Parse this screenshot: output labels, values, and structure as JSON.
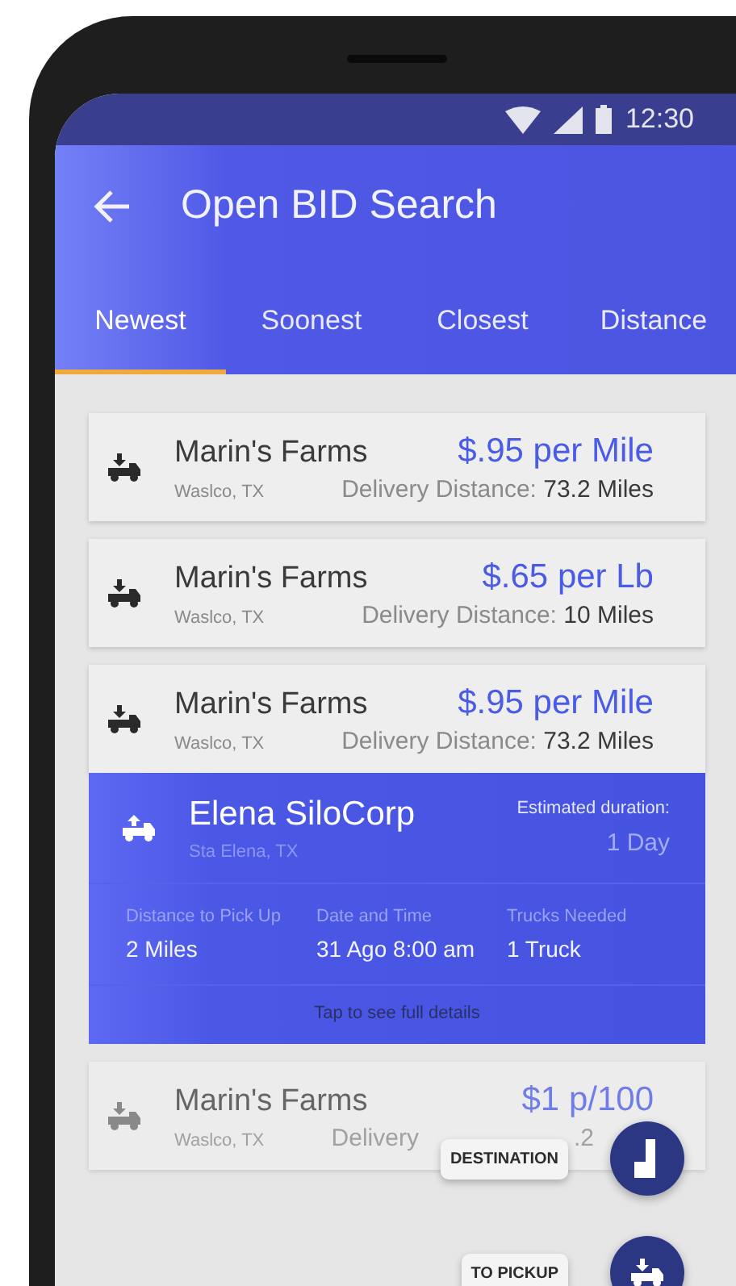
{
  "status_bar": {
    "time": "12:30"
  },
  "app_bar": {
    "title": "Open BID Search"
  },
  "tabs": [
    {
      "label": "Newest",
      "selected": true
    },
    {
      "label": "Soonest",
      "selected": false
    },
    {
      "label": "Closest",
      "selected": false
    },
    {
      "label": "Distance",
      "selected": false
    }
  ],
  "bids": [
    {
      "kind": "collapsed",
      "company": "Marin's Farms",
      "location": "Waslco, TX",
      "price": "$.95 per Mile",
      "distance_label": "Delivery Distance:",
      "distance_value": "73.2 Miles"
    },
    {
      "kind": "collapsed",
      "company": "Marin's Farms",
      "location": "Waslco, TX",
      "price": "$.65 per Lb",
      "distance_label": "Delivery Distance:",
      "distance_value": "10 Miles"
    },
    {
      "kind": "collapsed",
      "company": "Marin's Farms",
      "location": "Waslco, TX",
      "price": "$.95 per Mile",
      "distance_label": "Delivery Distance:",
      "distance_value": "73.2 Miles"
    },
    {
      "kind": "expanded",
      "company": "Elena SiloCorp",
      "location": "Sta Elena, TX",
      "duration_label": "Estimated duration:",
      "duration_value": "1 Day",
      "details": [
        {
          "label": "Distance to Pick Up",
          "value": "2 Miles"
        },
        {
          "label": "Date and Time",
          "value": "31 Ago 8:00 am"
        },
        {
          "label": "Trucks Needed",
          "value": "1 Truck"
        }
      ],
      "hint": "Tap to see full details"
    },
    {
      "kind": "partial",
      "company": "Marin's Farms",
      "location": "Waslco, TX",
      "price": "$1 p/100",
      "distance_parts": [
        "Delivery",
        ".2"
      ]
    }
  ],
  "fab_actions": [
    {
      "kind": "destination",
      "label": "DESTINATION"
    },
    {
      "kind": "pickup",
      "label": "TO PICKUP"
    }
  ]
}
